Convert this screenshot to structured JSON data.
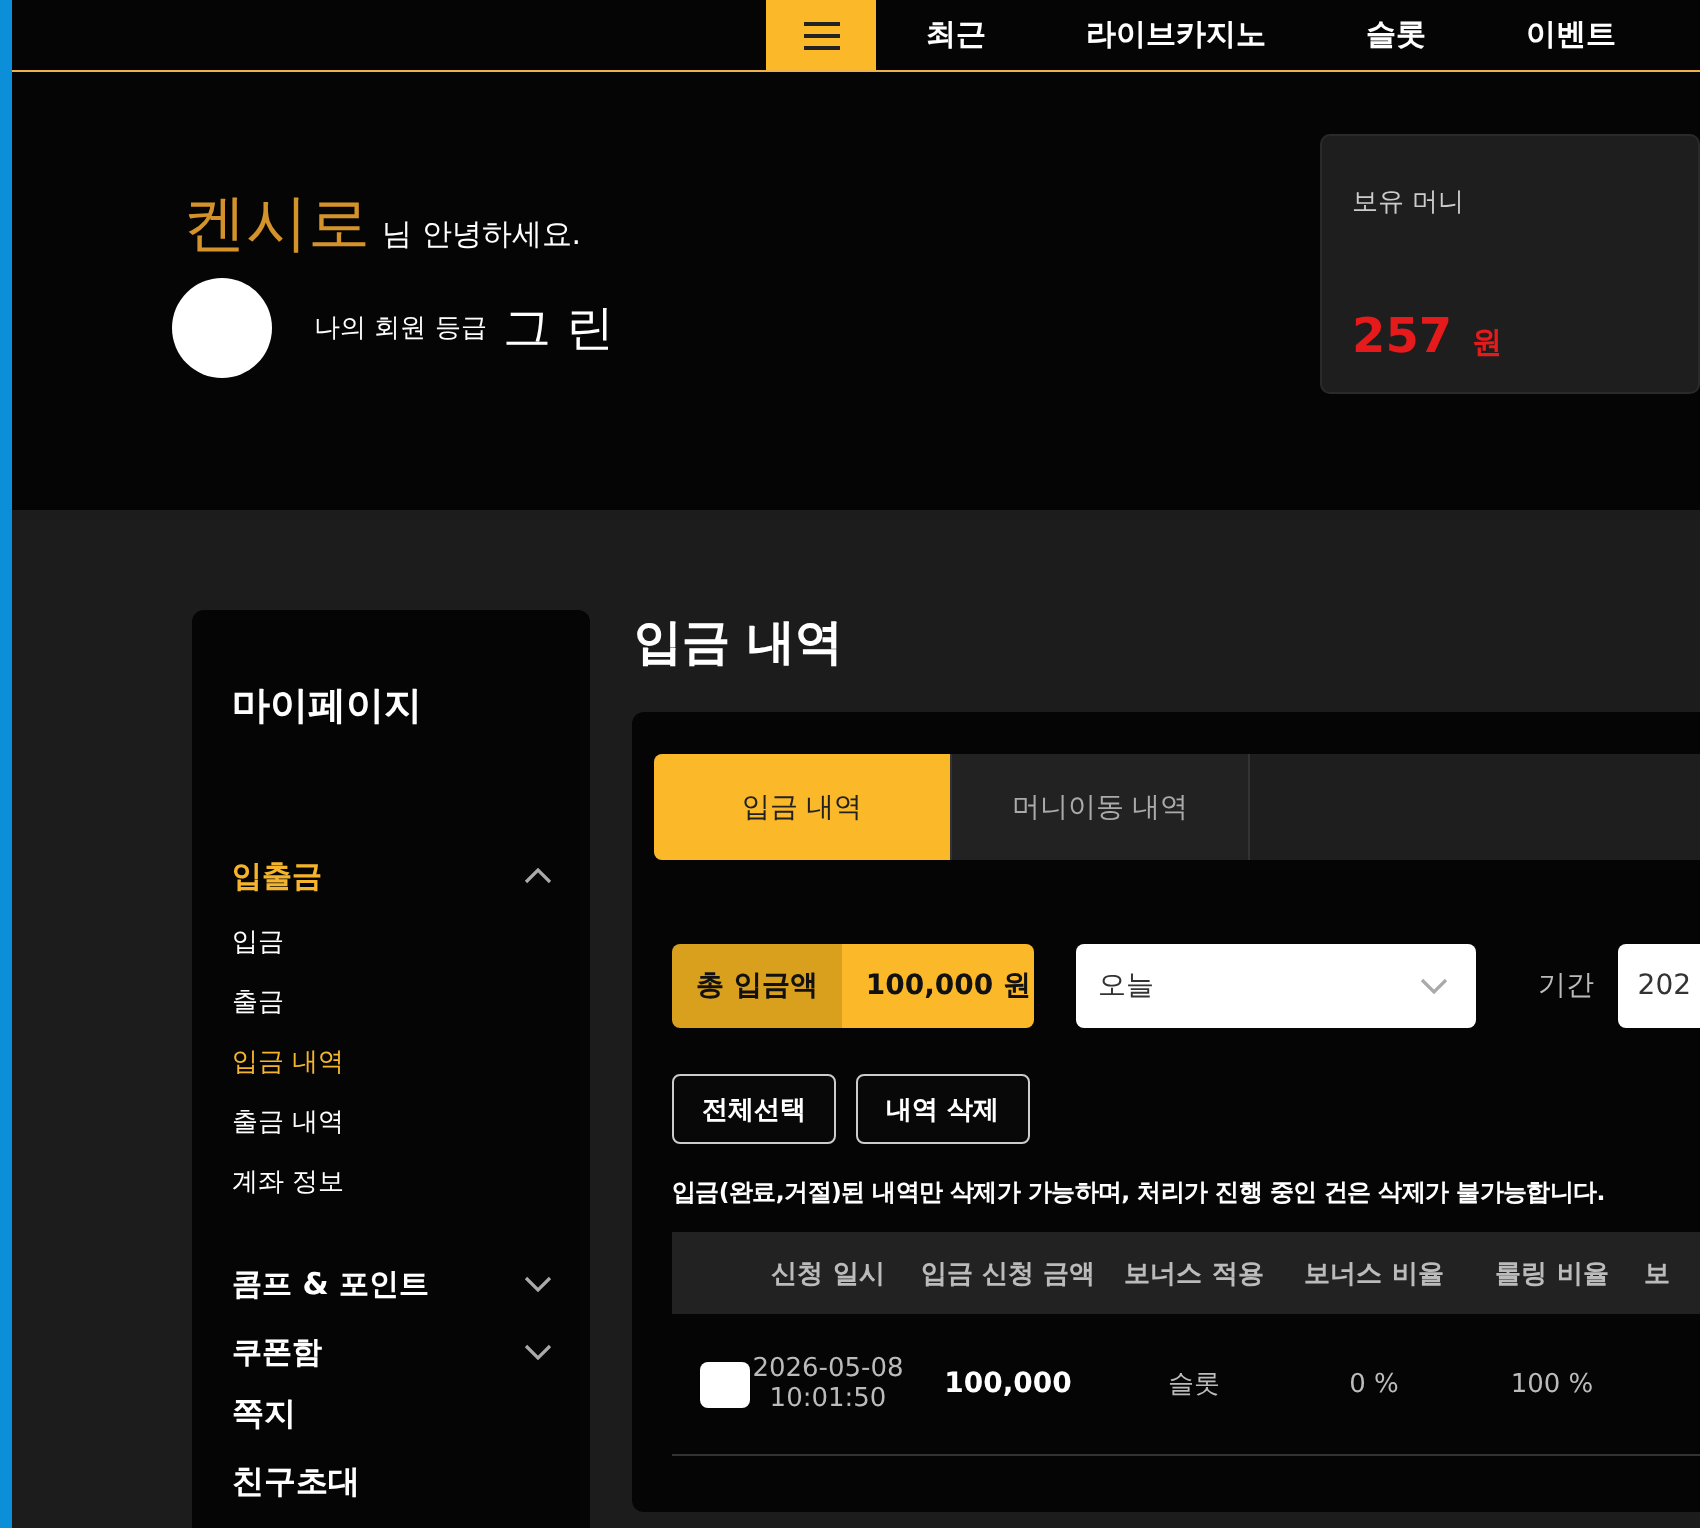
{
  "nav": {
    "items": [
      {
        "label": "최근"
      },
      {
        "label": "라이브카지노"
      },
      {
        "label": "슬롯"
      },
      {
        "label": "이벤트"
      }
    ]
  },
  "profile": {
    "name": "켄시로",
    "greeting": "님 안녕하세요.",
    "grade_label": "나의 회원 등급",
    "grade": "그 린"
  },
  "balance": {
    "label": "보유 머니",
    "amount": "257",
    "unit": "원"
  },
  "sidebar": {
    "title": "마이페이지",
    "menu": [
      {
        "kind": "group",
        "label": "입출금",
        "expanded": true,
        "children": [
          {
            "label": "입금",
            "selected": false
          },
          {
            "label": "출금",
            "selected": false
          },
          {
            "label": "입금 내역",
            "selected": true
          },
          {
            "label": "출금 내역",
            "selected": false
          },
          {
            "label": "계좌 정보",
            "selected": false
          }
        ]
      },
      {
        "kind": "group",
        "label": "콤프 & 포인트",
        "expanded": false
      },
      {
        "kind": "group",
        "label": "쿠폰함",
        "expanded": false
      },
      {
        "kind": "link",
        "label": "쪽지"
      },
      {
        "kind": "link",
        "label": "친구초대"
      }
    ]
  },
  "page_title": "입금 내역",
  "tabs": [
    {
      "label": "입금 내역",
      "selected": true
    },
    {
      "label": "머니이동 내역",
      "selected": false
    }
  ],
  "summary": {
    "label": "총 입금액",
    "value": "100,000 원"
  },
  "period_select": {
    "value": "오늘"
  },
  "period": {
    "label": "기간",
    "value": "202"
  },
  "buttons": [
    "전체선택",
    "내역 삭제"
  ],
  "notice": "입금(완료,거절)된 내역만 삭제가 가능하며, 처리가 진행 중인 건은 삭제가 불가능합니다.",
  "table": {
    "columns": [
      "신청 일시",
      "입금 신청 금액",
      "보너스 적용",
      "보너스 비율",
      "롤링 비율",
      "보"
    ],
    "rows": [
      {
        "checked": false,
        "date": "2026-05-08",
        "time": "10:01:50",
        "amount": "100,000",
        "bonus": "슬롯",
        "bonus_rate": "0 %",
        "rolling_rate": "100 %"
      }
    ]
  }
}
